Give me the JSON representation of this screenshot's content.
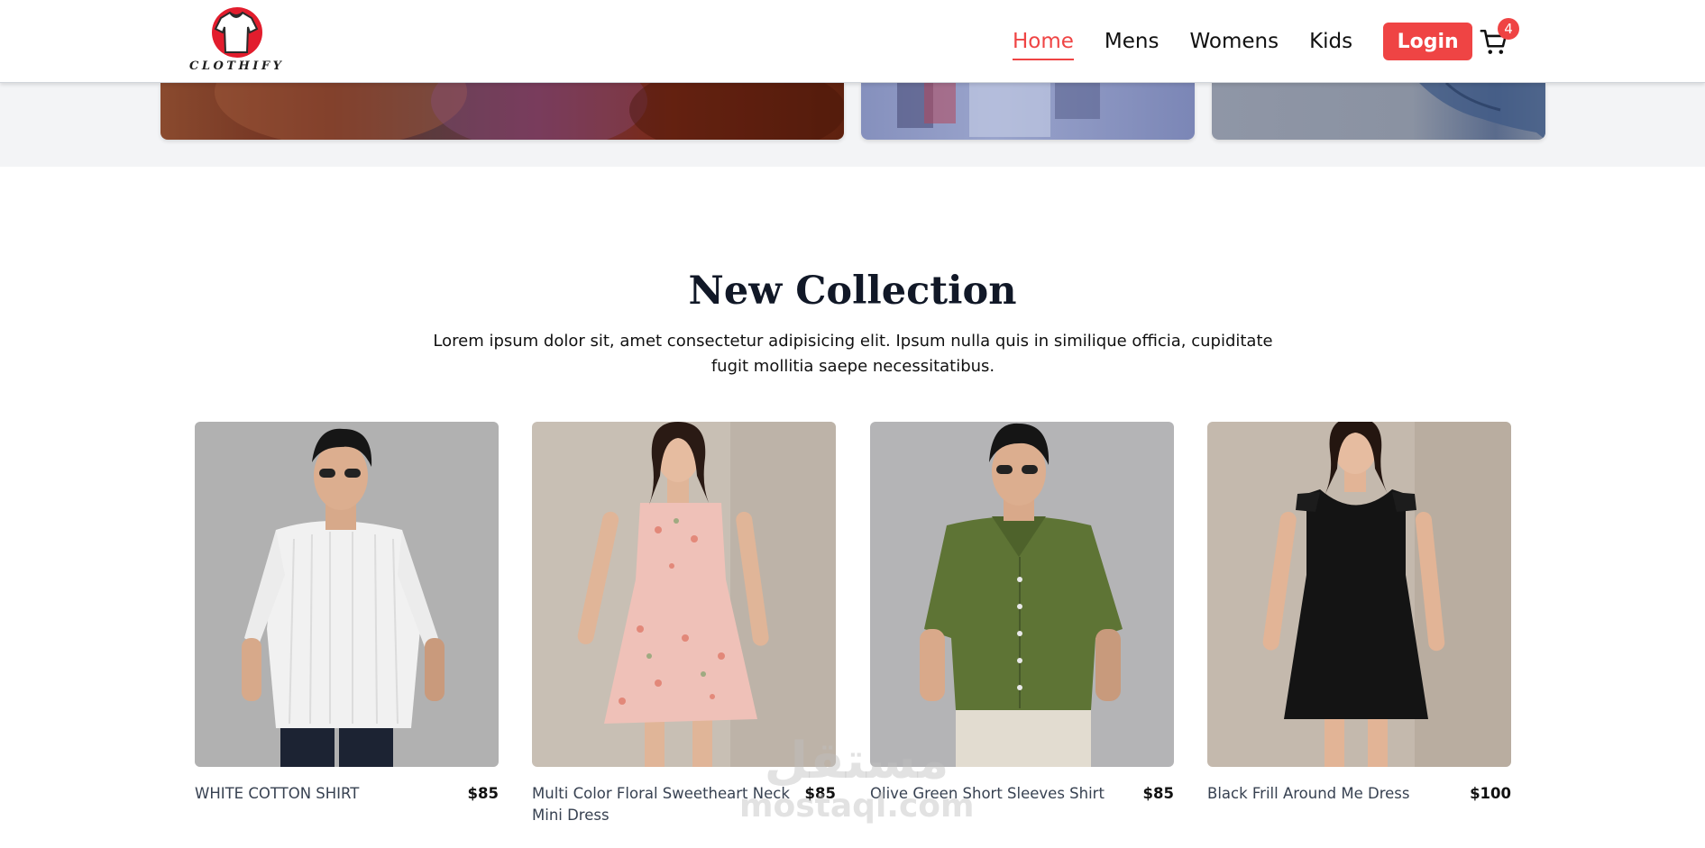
{
  "brand": {
    "name": "CLOTHIFY",
    "accent": "#ef4444"
  },
  "nav": {
    "items": [
      {
        "label": "Home",
        "active": true
      },
      {
        "label": "Mens",
        "active": false
      },
      {
        "label": "Womens",
        "active": false
      },
      {
        "label": "Kids",
        "active": false
      }
    ],
    "login_label": "Login",
    "cart_count": "4"
  },
  "section": {
    "title": "New Collection",
    "description": "Lorem ipsum dolor sit, amet consectetur adipisicing elit. Ipsum nulla quis in similique officia, cupiditate fugit mollitia saepe necessitatibus."
  },
  "products": [
    {
      "name": "WHITE COTTON SHIRT",
      "price": "$85"
    },
    {
      "name": "Multi Color Floral Sweetheart Neck Mini Dress",
      "price": "$85"
    },
    {
      "name": "Olive Green Short Sleeves Shirt",
      "price": "$85"
    },
    {
      "name": "Black Frill Around Me Dress",
      "price": "$100"
    }
  ],
  "watermark": {
    "arabic": "مستقل",
    "latin": "mostaql.com"
  }
}
